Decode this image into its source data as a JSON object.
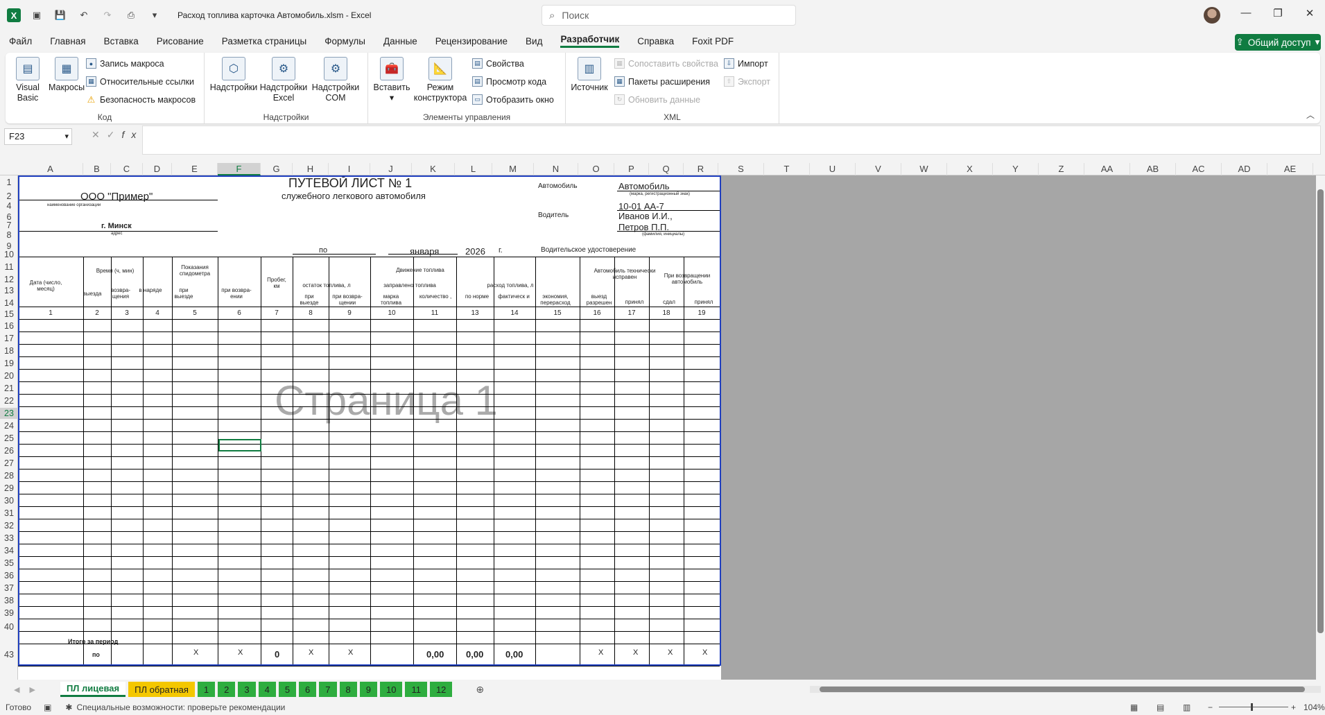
{
  "title_bar": {
    "doc_title": "Расход топлива карточка Автомобиль.xlsm  -  Excel",
    "search_placeholder": "Поиск"
  },
  "menu": [
    "Файл",
    "Главная",
    "Вставка",
    "Рисование",
    "Разметка страницы",
    "Формулы",
    "Данные",
    "Рецензирование",
    "Вид",
    "Разработчик",
    "Справка",
    "Foxit PDF"
  ],
  "share_label": "Общий доступ",
  "ribbon": {
    "code": {
      "label": "Код",
      "visual_basic": "Visual Basic",
      "macros": "Макросы",
      "record_macro": "Запись макроса",
      "relative_refs": "Относительные ссылки",
      "macro_security": "Безопасность макросов"
    },
    "addins": {
      "label": "Надстройки",
      "addins": "Надстройки",
      "excel_addins": "Надстройки Excel",
      "com_addins": "Надстройки COM"
    },
    "controls": {
      "label": "Элементы управления",
      "insert": "Вставить",
      "design_mode": "Режим конструктора",
      "properties": "Свойства",
      "view_code": "Просмотр кода",
      "show_window": "Отобразить окно"
    },
    "xml": {
      "label": "XML",
      "source": "Источник",
      "map_properties": "Сопоставить свойства",
      "expansion_packs": "Пакеты расширения",
      "refresh_data": "Обновить данные",
      "import": "Импорт",
      "export": "Экспорт"
    }
  },
  "formula_bar": {
    "name_box": "F23",
    "formula": ""
  },
  "columns": [
    "A",
    "B",
    "C",
    "D",
    "E",
    "F",
    "G",
    "H",
    "I",
    "J",
    "K",
    "L",
    "M",
    "N",
    "O",
    "P",
    "Q",
    "R",
    "S",
    "T",
    "U",
    "V",
    "W",
    "X",
    "Y",
    "Z",
    "AA",
    "AB",
    "AC",
    "AD",
    "AE"
  ],
  "rows": [
    "1",
    "2",
    "4",
    "6",
    "7",
    "8",
    "9",
    "10",
    "11",
    "12",
    "13",
    "14",
    "15",
    "16",
    "17",
    "18",
    "19",
    "20",
    "21",
    "22",
    "23",
    "24",
    "25",
    "26",
    "27",
    "28",
    "29",
    "30",
    "31",
    "32",
    "33",
    "34",
    "35",
    "36",
    "37",
    "38",
    "39",
    "40",
    "43"
  ],
  "sheet": {
    "title": "ПУТЕВОЙ ЛИСТ № 1",
    "subtitle": "служебного легкового автомобиля",
    "org": "ООО \"Пример\"",
    "org_caption": "наименование организации",
    "city": "г. Минск",
    "city_caption": "адрес",
    "car_label": "Автомобиль",
    "car_value": "Автомобиль",
    "car_caption": "(марка, регистрационный знак)",
    "plate": "10-01 АА-7",
    "driver_label": "Водитель",
    "driver1": "Иванов И.И.,",
    "driver2": "Петров П.П.",
    "driver_caption": "(фамилия, инициалы)",
    "po": "по",
    "month": "января",
    "year": "2026",
    "g": "г.",
    "license": "Водительское удостоверение",
    "h_date": "Дата (число, месяц)",
    "h_time": "Время (ч, мин)",
    "h_out": "выезда",
    "h_ret": "возвра-щения",
    "h_duty": "в наряде",
    "h_odo": "Показания спидометра",
    "h_odo_out": "при выезде",
    "h_odo_ret": "при возвра-ении",
    "h_run": "Пробег, км",
    "h_fuelmove": "Движение топлива",
    "h_rest": "остаток топлива, л",
    "h_rest_out": "при выезде",
    "h_rest_ret": "при возвра-щении",
    "h_filled": "заправлено топлива",
    "h_brand": "марка топлива",
    "h_qty": "количество ,",
    "h_consumption": "расход топлива, л",
    "h_norm": "по норме",
    "h_fact": "фактическ и",
    "h_econ": "экономия, перерасход",
    "h_techok": "Автомобиль технически исправен",
    "h_exit_ok": "выезд разрешен",
    "h_accepted": "принял",
    "h_return": "При возвращении автомобиль",
    "h_gave": "сдал",
    "h_took": "принял",
    "col_numbers": [
      "1",
      "2",
      "3",
      "4",
      "5",
      "6",
      "7",
      "8",
      "9",
      "10",
      "11",
      "13",
      "14",
      "15",
      "16",
      "17",
      "18",
      "19"
    ],
    "total_label": "Итого за период",
    "total_po": "по",
    "x_mark": "X",
    "run_total": "0",
    "qty_total": "0,00",
    "norm_total": "0,00",
    "fact_total": "0,00",
    "watermark": "Страница 1"
  },
  "tabs": [
    "ПЛ лицевая",
    "ПЛ обратная",
    "1",
    "2",
    "3",
    "4",
    "5",
    "6",
    "7",
    "8",
    "9",
    "10",
    "11",
    "12"
  ],
  "status": {
    "ready": "Готово",
    "accessibility": "Специальные возможности: проверьте рекомендации",
    "zoom": "104%"
  }
}
